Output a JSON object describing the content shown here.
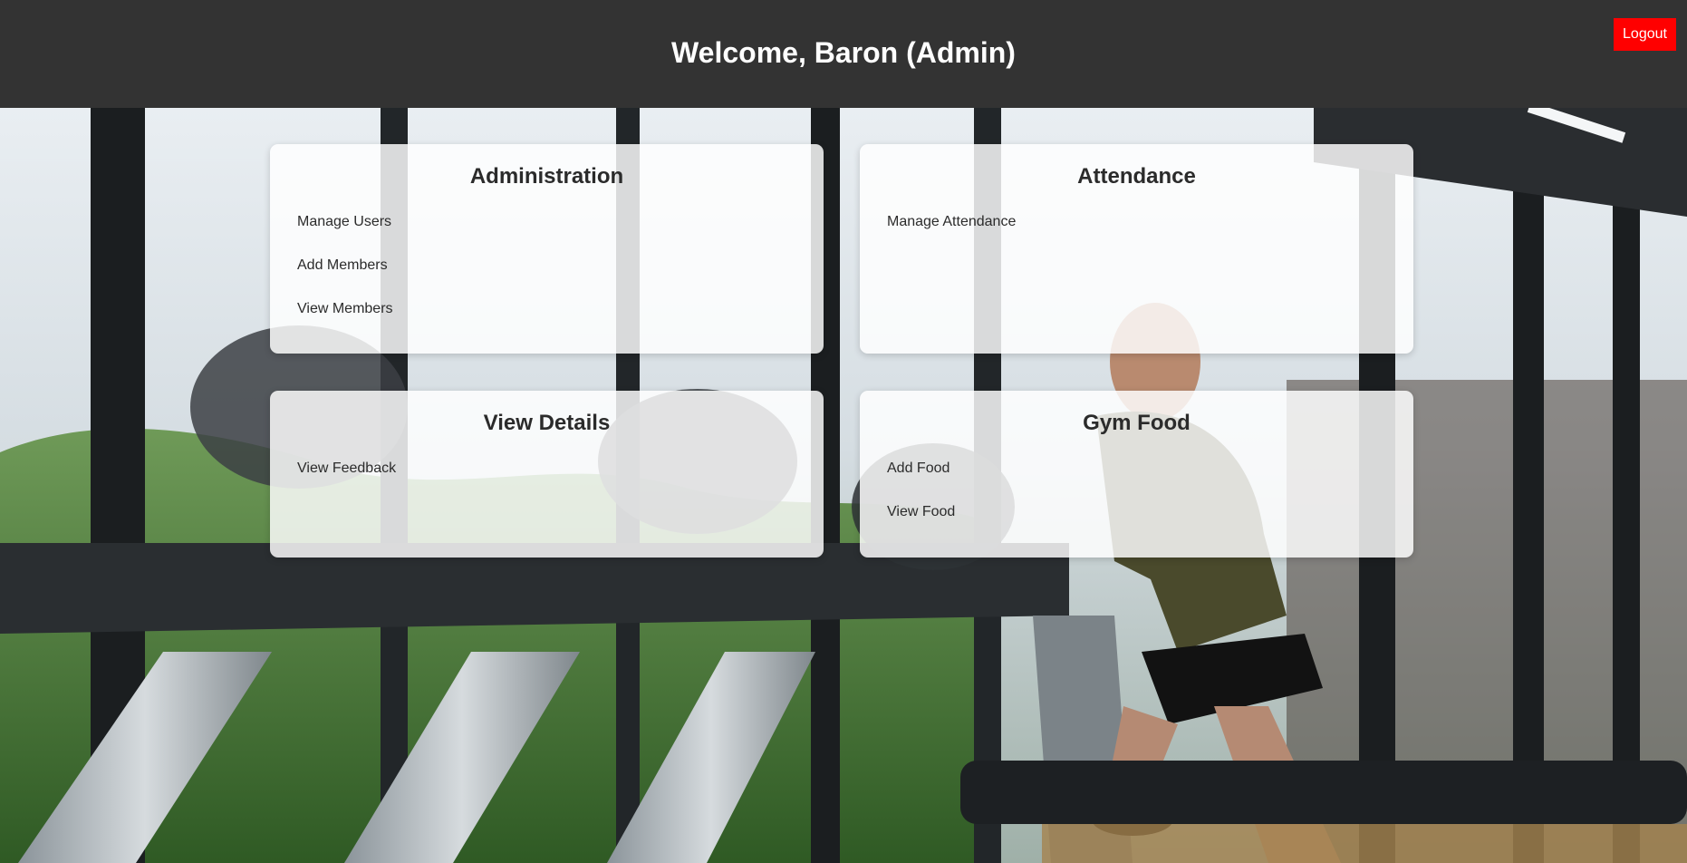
{
  "header": {
    "title": "Welcome, Baron (Admin)",
    "logout_label": "Logout",
    "background": "#333333",
    "logout_color": "#ff0000"
  },
  "panels": [
    {
      "title": "Administration",
      "links": [
        "Manage Users",
        "Add Members",
        "View Members"
      ]
    },
    {
      "title": "Attendance",
      "links": [
        "Manage Attendance"
      ]
    },
    {
      "title": "View Details",
      "links": [
        "View Feedback"
      ]
    },
    {
      "title": "Gym Food",
      "links": [
        "Add Food",
        "View Food"
      ]
    }
  ],
  "background_photo": "gym-treadmill-runner"
}
